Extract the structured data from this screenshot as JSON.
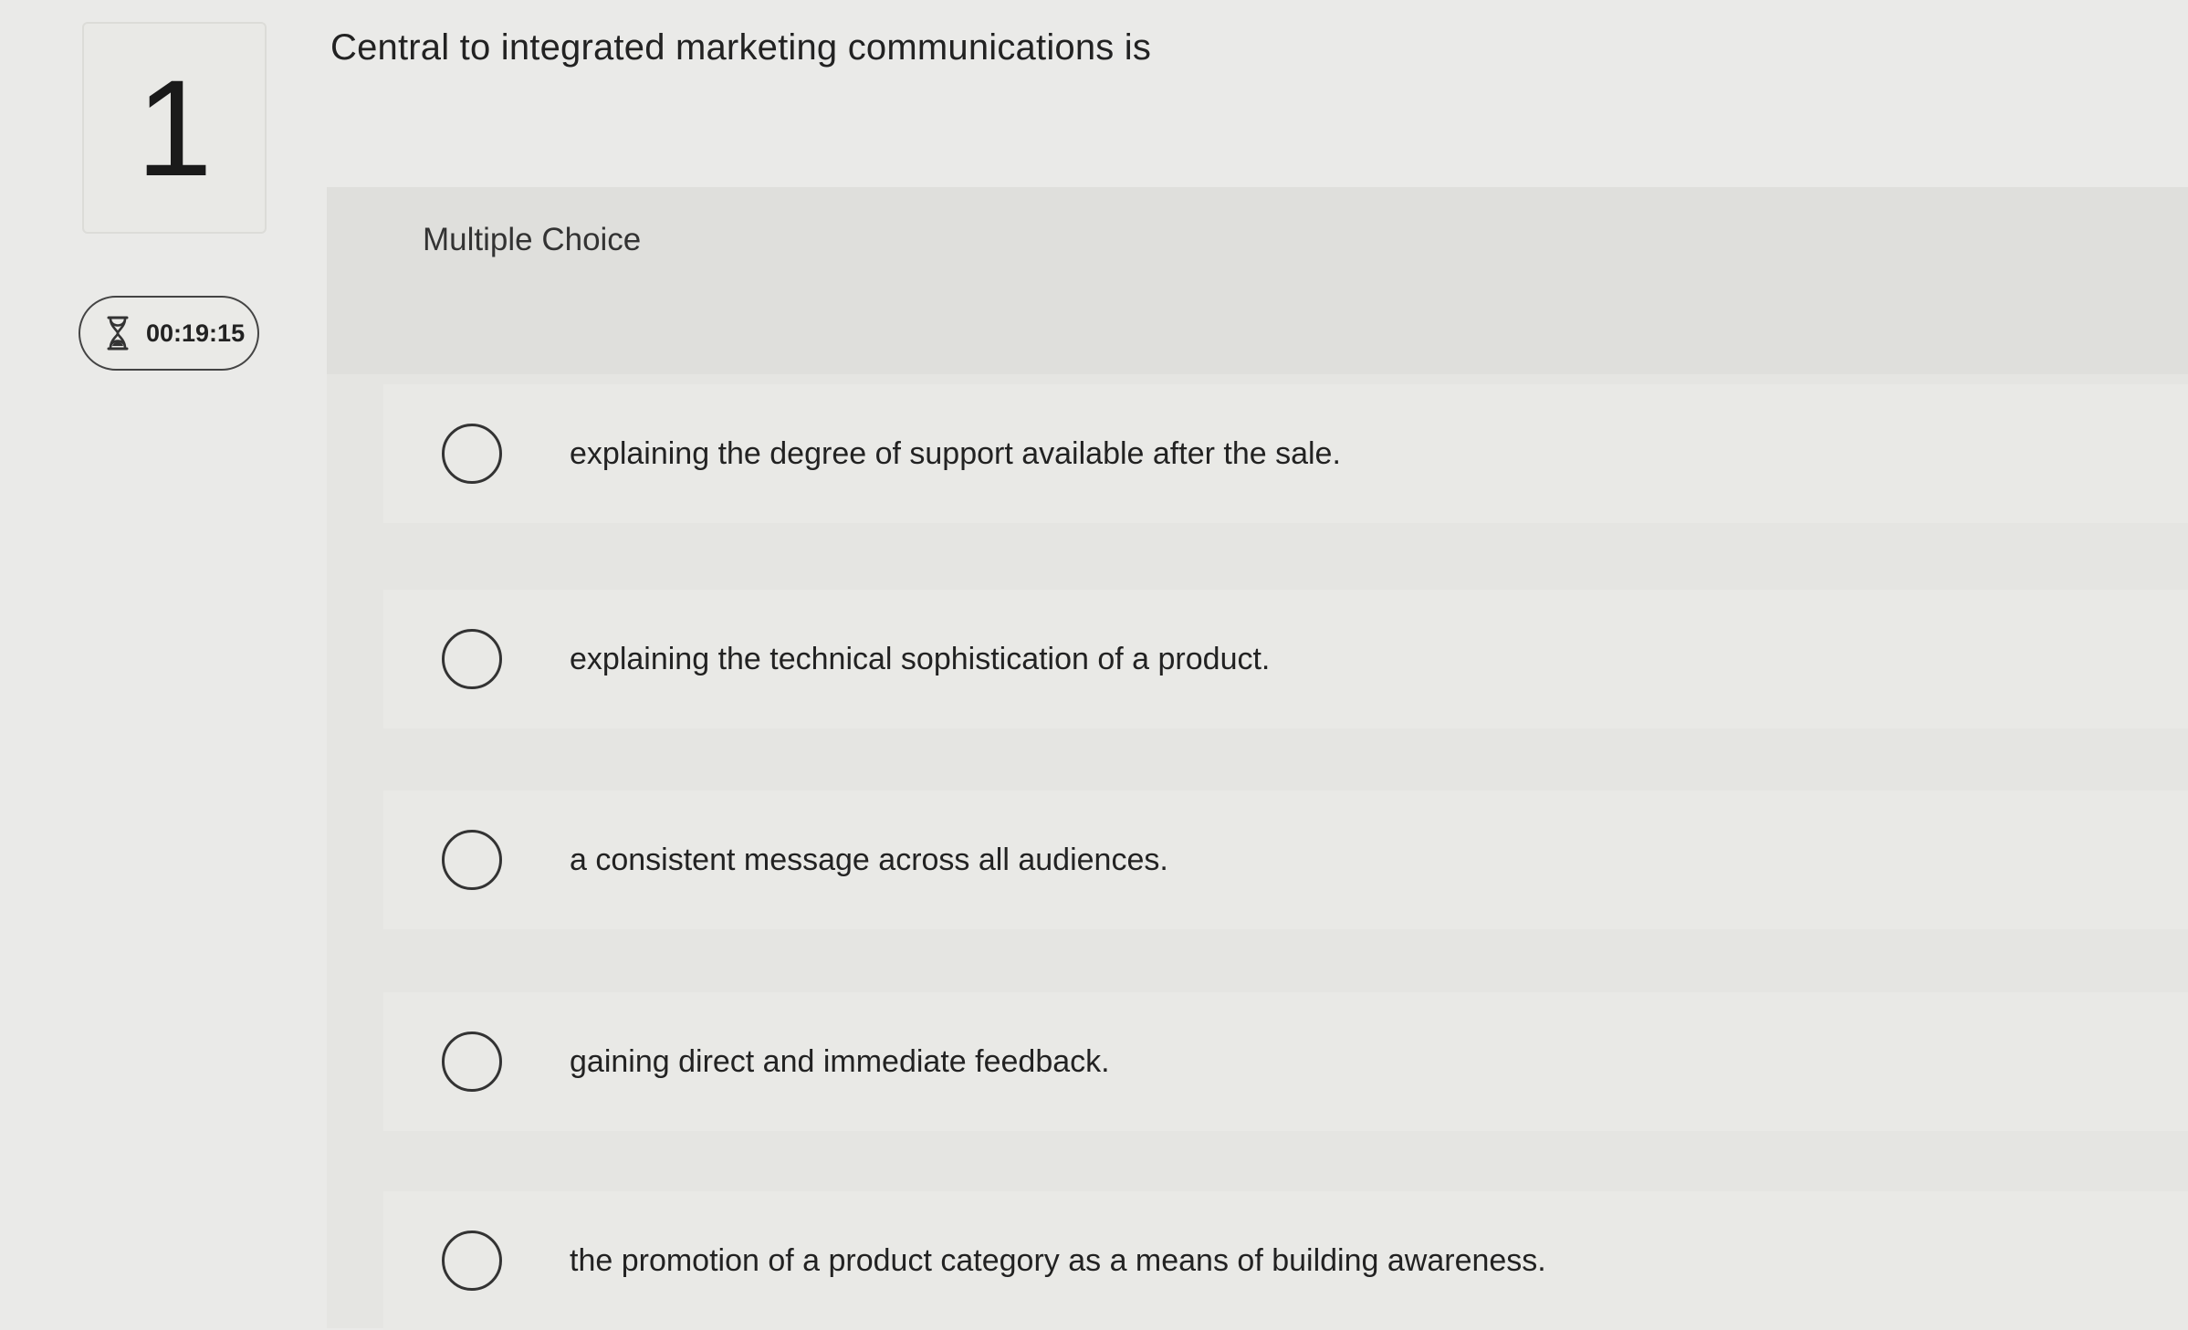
{
  "question": {
    "number": "1",
    "text": "Central to integrated marketing communications is",
    "type_label": "Multiple Choice"
  },
  "timer": {
    "icon": "hourglass-icon",
    "value": "00:19:15"
  },
  "options": [
    {
      "label": "explaining the degree of support available after the sale."
    },
    {
      "label": "explaining the technical sophistication of a product."
    },
    {
      "label": "a consistent message across all audiences."
    },
    {
      "label": "gaining direct and immediate feedback."
    },
    {
      "label": "the promotion of a product category as a means of building awareness."
    }
  ]
}
